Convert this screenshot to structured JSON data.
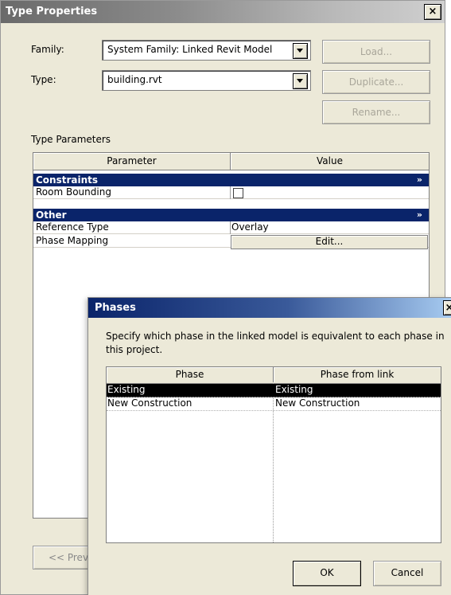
{
  "type_properties": {
    "title": "Type Properties",
    "close_glyph": "×",
    "family_label": "Family:",
    "family_value": "System Family: Linked Revit Model",
    "type_label": "Type:",
    "type_value": "building.rvt",
    "load_button": "Load...",
    "duplicate_button": "Duplicate...",
    "rename_button": "Rename...",
    "section_label": "Type Parameters",
    "columns": [
      "Parameter",
      "Value"
    ],
    "groups": [
      {
        "name": "Constraints",
        "collapse_glyph": "»"
      },
      {
        "name": "Other",
        "collapse_glyph": "»"
      }
    ],
    "rows": [
      {
        "name": "Room Bounding",
        "value": ""
      },
      {
        "name": "Reference Type",
        "value": "Overlay"
      },
      {
        "name": "Phase Mapping",
        "value": "Edit..."
      }
    ],
    "preview_button": "<< Prev"
  },
  "phases_dialog": {
    "title": "Phases",
    "close_glyph": "×",
    "description": "Specify which phase in the linked model is equivalent to each phase in this project.",
    "columns": [
      "Phase",
      "Phase from link"
    ],
    "rows": [
      {
        "phase": "Existing",
        "phase_from_link": "Existing",
        "selected": true
      },
      {
        "phase": "New Construction",
        "phase_from_link": "New Construction",
        "selected": false
      }
    ],
    "ok_button": "OK",
    "cancel_button": "Cancel"
  },
  "colors": {
    "group_header": "#0a246a",
    "dialog_face": "#ece9d8",
    "selection": "#000000"
  }
}
